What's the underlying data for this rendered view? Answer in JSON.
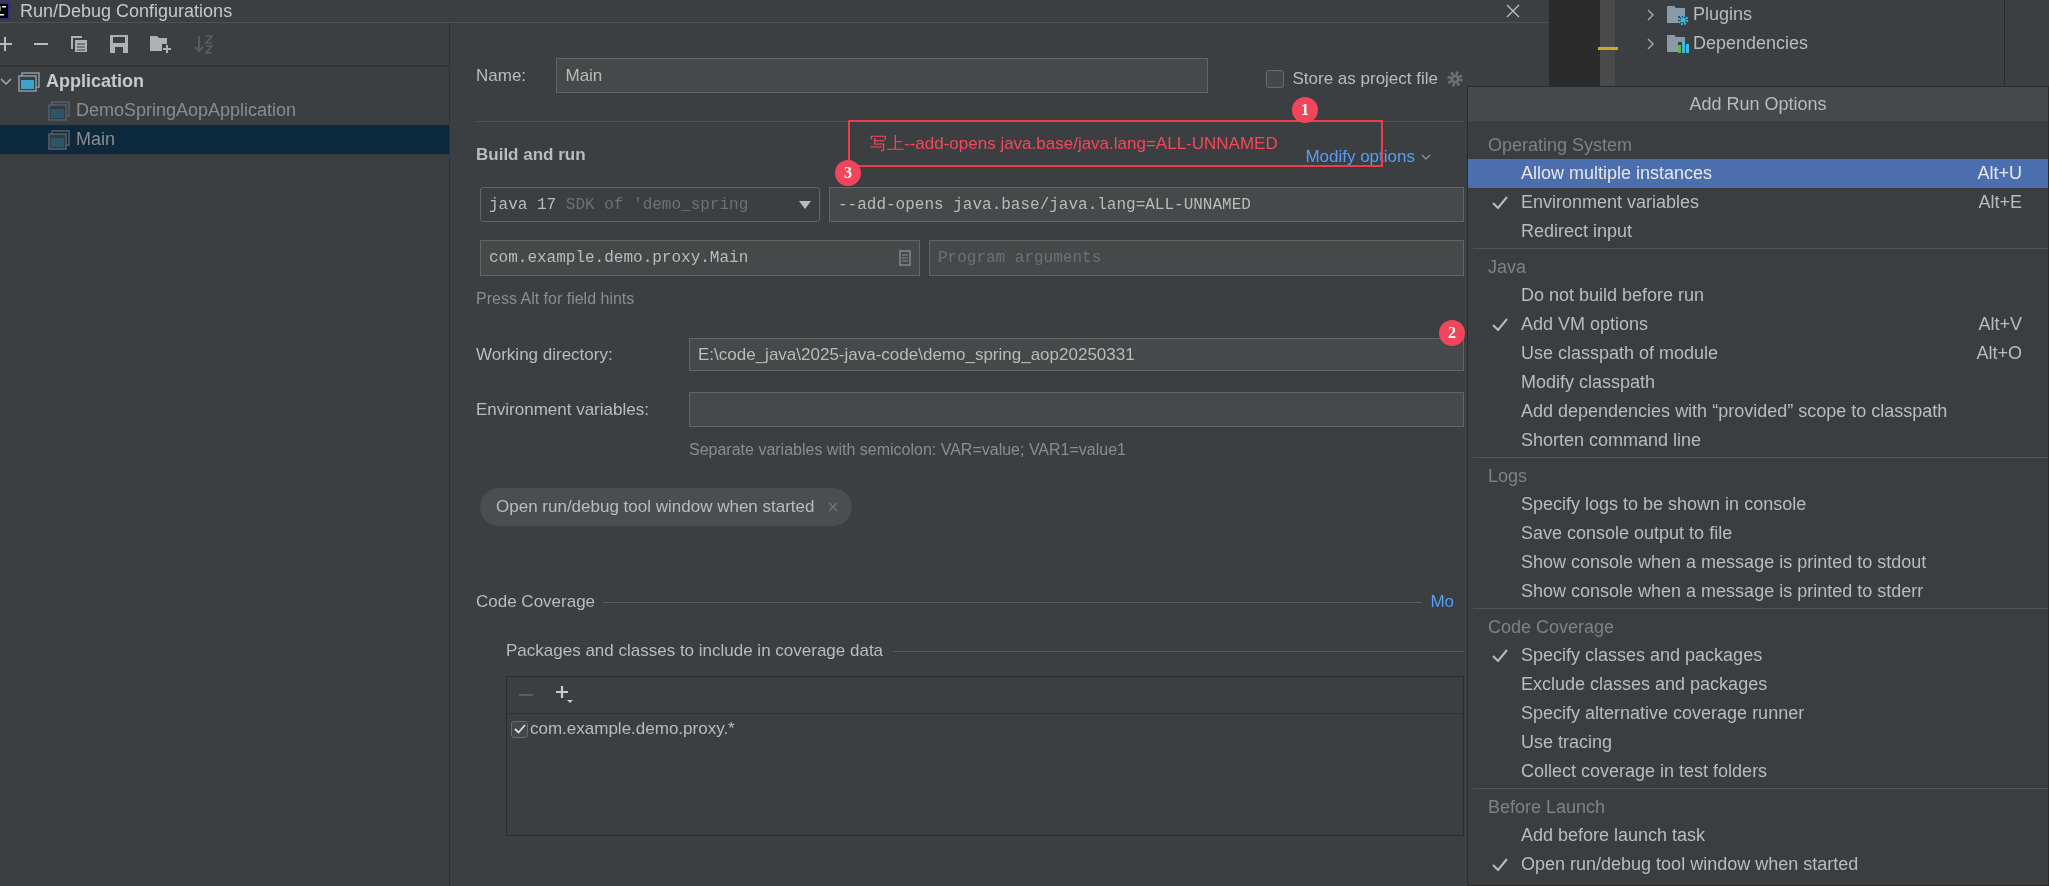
{
  "window": {
    "title": "Run/Debug Configurations"
  },
  "tree": [
    {
      "label": "Application",
      "expanded": true,
      "selected": false,
      "children": [
        {
          "label": "DemoSpringAopApplication",
          "selected": false
        },
        {
          "label": "Main",
          "selected": true
        }
      ]
    }
  ],
  "form": {
    "name_label": "Name:",
    "name_value": "Main",
    "store_as_project_file": {
      "label": "Store as project file",
      "checked": false
    },
    "section_title": "Build and run",
    "modify_options": "Modify options",
    "jre": {
      "value": "java 17",
      "hint": "SDK of 'demo_spring"
    },
    "vm_options": "--add-opens java.base/java.lang=ALL-UNNAMED",
    "main_class": "com.example.demo.proxy.Main",
    "program_arguments": {
      "placeholder": "Program arguments"
    },
    "field_hint": "Press Alt for field hints",
    "working_directory": {
      "label": "Working directory:",
      "value": "E:\\code_java\\2025-java-code\\demo_spring_aop20250331"
    },
    "environment_variables": {
      "label": "Environment variables:",
      "hint": "Separate variables with semicolon: VAR=value; VAR1=value1"
    },
    "chips": [
      {
        "label": "Open run/debug tool window when started"
      }
    ],
    "code_coverage": {
      "title": "Code Coverage",
      "modify_link": "Mo",
      "subtitle": "Packages and classes to include in coverage data",
      "patterns": [
        {
          "label": "com.example.demo.proxy.*",
          "checked": true
        }
      ]
    }
  },
  "annotation": {
    "text": "写上--add-opens java.base/java.lang=ALL-UNNAMED",
    "markers": [
      "1",
      "2",
      "3"
    ]
  },
  "project_tree": [
    {
      "label": "Plugins"
    },
    {
      "label": "Dependencies"
    }
  ],
  "popup": {
    "title": "Add Run Options",
    "groups": [
      {
        "title": "Operating System",
        "items": [
          {
            "label": "Allow multiple instances",
            "shortcut": "Alt+U",
            "checked": false,
            "selected": true
          },
          {
            "label": "Environment variables",
            "shortcut": "Alt+E",
            "checked": true,
            "selected": false
          },
          {
            "label": "Redirect input",
            "checked": false,
            "selected": false
          }
        ]
      },
      {
        "title": "Java",
        "items": [
          {
            "label": "Do not build before run",
            "checked": false,
            "selected": false
          },
          {
            "label": "Add VM options",
            "shortcut": "Alt+V",
            "checked": true,
            "selected": false
          },
          {
            "label": "Use classpath of module",
            "shortcut": "Alt+O",
            "checked": false,
            "selected": false
          },
          {
            "label": "Modify classpath",
            "checked": false,
            "selected": false
          },
          {
            "label": "Add dependencies with “provided” scope to classpath",
            "checked": false,
            "selected": false
          },
          {
            "label": "Shorten command line",
            "checked": false,
            "selected": false
          }
        ]
      },
      {
        "title": "Logs",
        "items": [
          {
            "label": "Specify logs to be shown in console",
            "checked": false,
            "selected": false
          },
          {
            "label": "Save console output to file",
            "checked": false,
            "selected": false
          },
          {
            "label": "Show console when a message is printed to stdout",
            "checked": false,
            "selected": false
          },
          {
            "label": "Show console when a message is printed to stderr",
            "checked": false,
            "selected": false
          }
        ]
      },
      {
        "title": "Code Coverage",
        "items": [
          {
            "label": "Specify classes and packages",
            "checked": true,
            "selected": false
          },
          {
            "label": "Exclude classes and packages",
            "checked": false,
            "selected": false
          },
          {
            "label": "Specify alternative coverage runner",
            "checked": false,
            "selected": false
          },
          {
            "label": "Use tracing",
            "checked": false,
            "selected": false
          },
          {
            "label": "Collect coverage in test folders",
            "checked": false,
            "selected": false
          }
        ]
      },
      {
        "title": "Before Launch",
        "items": [
          {
            "label": "Add before launch task",
            "checked": false,
            "selected": false
          },
          {
            "label": "Open run/debug tool window when started",
            "checked": true,
            "selected": false
          }
        ]
      }
    ]
  }
}
